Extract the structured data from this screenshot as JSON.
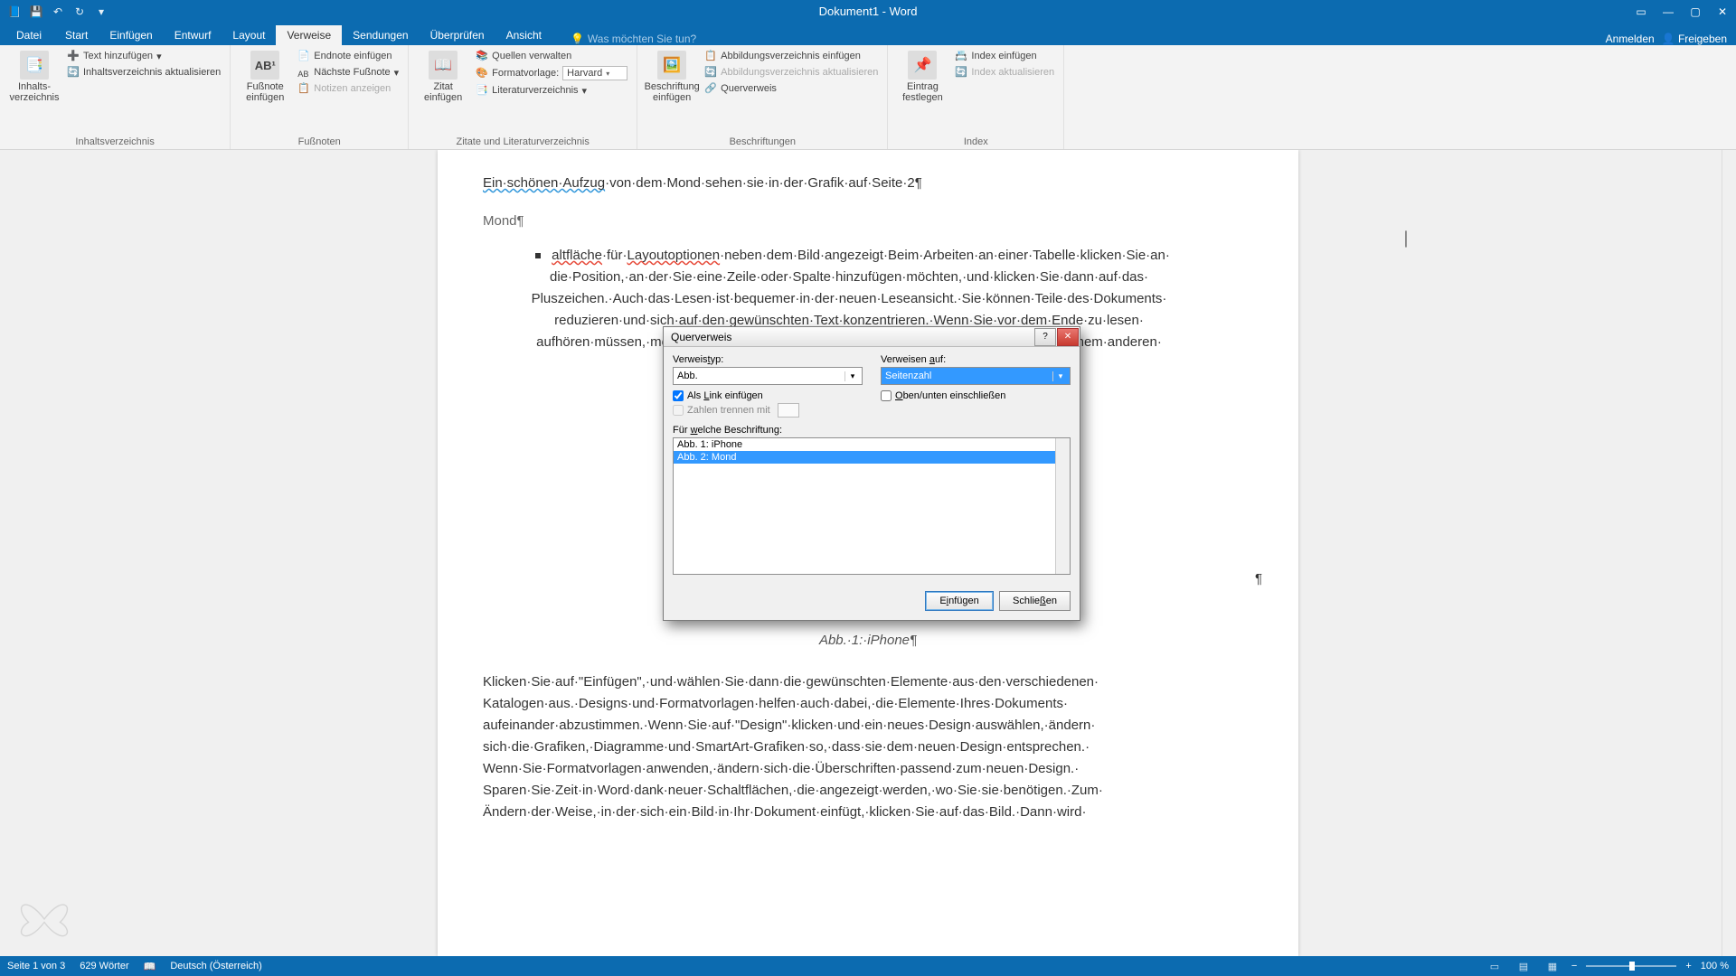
{
  "titlebar": {
    "title": "Dokument1 - Word"
  },
  "tabs": {
    "file": "Datei",
    "start": "Start",
    "einfuegen": "Einfügen",
    "entwurf": "Entwurf",
    "layout": "Layout",
    "verweise": "Verweise",
    "sendungen": "Sendungen",
    "ueberpruefen": "Überprüfen",
    "ansicht": "Ansicht",
    "tell_me": "Was möchten Sie tun?",
    "anmelden": "Anmelden",
    "freigeben": "Freigeben"
  },
  "ribbon": {
    "toc": {
      "btn": "Inhalts-\nverzeichnis",
      "add_text": "Text hinzufügen",
      "update": "Inhaltsverzeichnis aktualisieren",
      "group": "Inhaltsverzeichnis"
    },
    "footnotes": {
      "insert": "Fußnote\neinfügen",
      "endnote": "Endnote einfügen",
      "next": "Nächste Fußnote",
      "show": "Notizen anzeigen",
      "group": "Fußnoten",
      "ab": "AB¹"
    },
    "citations": {
      "insert": "Zitat\neinfügen",
      "manage": "Quellen verwalten",
      "style_label": "Formatvorlage:",
      "style_value": "Harvard",
      "biblio": "Literaturverzeichnis",
      "group": "Zitate und Literaturverzeichnis"
    },
    "captions": {
      "insert": "Beschriftung\neinfügen",
      "insert_fig": "Abbildungsverzeichnis einfügen",
      "update_fig": "Abbildungsverzeichnis aktualisieren",
      "crossref": "Querverweis",
      "group": "Beschriftungen"
    },
    "index": {
      "mark": "Eintrag\nfestlegen",
      "insert": "Index einfügen",
      "update": "Index aktualisieren",
      "group": "Index"
    }
  },
  "doc": {
    "line1_a": "Ein·schönen·Aufzug",
    "line1_b": "·von·dem·Mond·sehen·sie·in·der·Grafik·auf·Seite·2¶",
    "mond": "Mond¶",
    "para1_wavy": "altfläche",
    "para1_wavy2": "Layoutoptionen",
    "para1_rest": "·für·",
    "para1_body": "·neben·dem·Bild·angezeigt·Beim·Arbeiten·an·einer·Tabelle·klicken·Sie·an· die·Position,·an·der·Sie·eine·Zeile·oder·Spalte·hinzufügen·möchten,·und·klicken·Sie·dann·auf·das· Pluszeichen.·Auch·das·Lesen·ist·bequemer·in·der·neuen·Leseansicht.·Sie·können·Teile·des·Dokuments· reduzieren·und·sich·auf·den·gewünschten·Text·konzentrieren.·Wenn·Sie·vor·dem·Ende·zu·lesen· aufhören·müssen,·merkt·sich·Word·die·Stelle,·bis·zu·der·Sie·gelangt·sind·—·sogar·auf·einem·anderen· Gerät.·Video·biete                                                                                                                                              unkts.·Wenn·Sie· auf·\"Onlinevideo\"                                                                                                                                           ·das·hinzugefügt· werden·soll.·Sie·k                                                                                                                                          t·zu·suchen,·der· optimal·zu·Ihrem                                                                                                                                          ·erhält,·stellt· Word·einander·er                                                                                                                                           ·zur·Verfügung.· Beispielsweise                                                                                                                                                hinzufügen.",
    "caption": "Abb.·1:·iPhone¶",
    "pilcrow": "¶",
    "para2": "Klicken·Sie·auf·\"Einfügen\",·und·wählen·Sie·dann·die·gewünschten·Elemente·aus·den·verschiedenen· Katalogen·aus.·Designs·und·Formatvorlagen·helfen·auch·dabei,·die·Elemente·Ihres·Dokuments· aufeinander·abzustimmen.·Wenn·Sie·auf·\"Design\"·klicken·und·ein·neues·Design·auswählen,·ändern· sich·die·Grafiken,·Diagramme·und·SmartArt-Grafiken·so,·dass·sie·dem·neuen·Design·entsprechen.· Wenn·Sie·Formatvorlagen·anwenden,·ändern·sich·die·Überschriften·passend·zum·neuen·Design.· Sparen·Sie·Zeit·in·Word·dank·neuer·Schaltflächen,·die·angezeigt·werden,·wo·Sie·sie·benötigen.·Zum· Ändern·der·Weise,·in·der·sich·ein·Bild·in·Ihr·Dokument·einfügt,·klicken·Sie·auf·das·Bild.·Dann·wird·"
  },
  "dialog": {
    "title": "Querverweis",
    "type_label": "Verweistyp:",
    "type_value": "Abb.",
    "refto_label": "Verweisen auf:",
    "refto_value": "Seitenzahl",
    "as_link": "Als Link einfügen",
    "above_below": "Oben/unten einschließen",
    "sep_numbers": "Zahlen trennen mit",
    "which_label": "Für welche Beschriftung:",
    "items": [
      "Abb. 1: iPhone",
      "Abb. 2: Mond"
    ],
    "insert_btn": "Einfügen",
    "close_btn": "Schließen"
  },
  "status": {
    "page": "Seite 1 von 3",
    "words": "629 Wörter",
    "lang": "Deutsch (Österreich)",
    "zoom": "100 %"
  }
}
